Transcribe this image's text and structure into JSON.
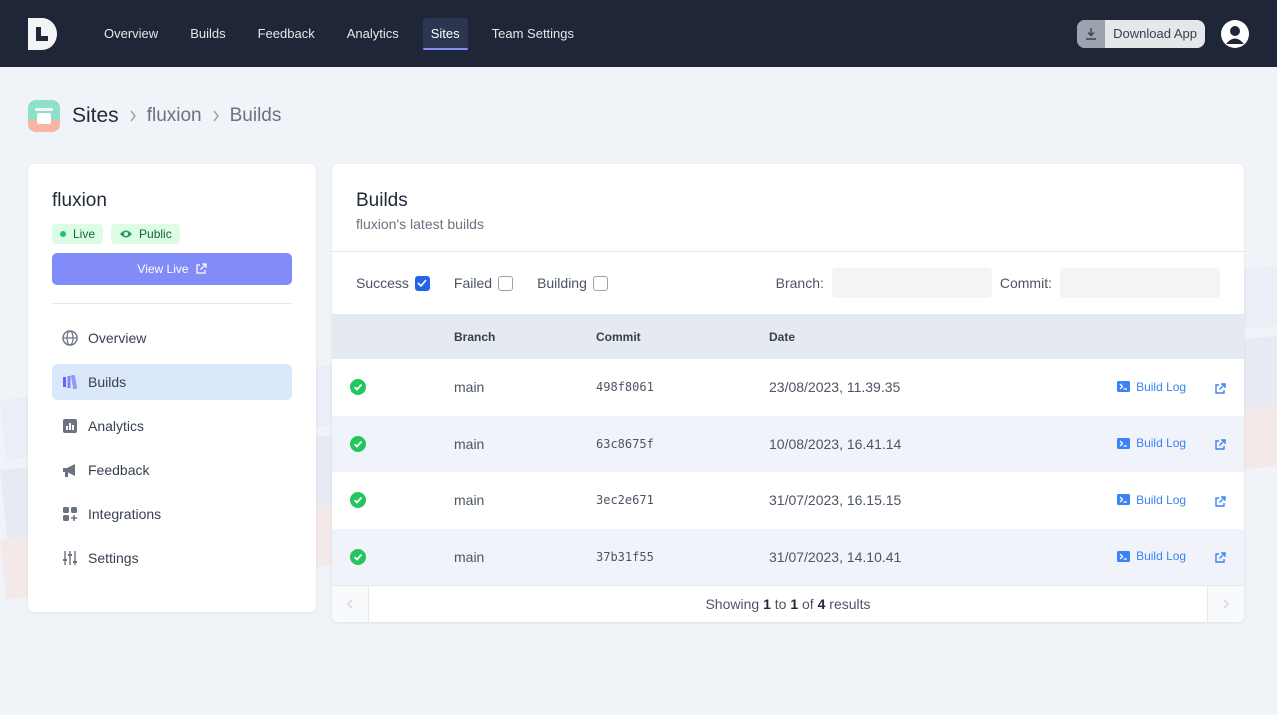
{
  "nav": {
    "items": [
      {
        "label": "Overview",
        "active": false
      },
      {
        "label": "Builds",
        "active": false
      },
      {
        "label": "Feedback",
        "active": false
      },
      {
        "label": "Analytics",
        "active": false
      },
      {
        "label": "Sites",
        "active": true
      },
      {
        "label": "Team Settings",
        "active": false
      }
    ],
    "download_label": "Download App"
  },
  "breadcrumb": [
    "Sites",
    "fluxion",
    "Builds"
  ],
  "site": {
    "name": "fluxion",
    "badges": {
      "live": "Live",
      "public": "Public"
    },
    "view_live_label": "View Live",
    "menu": [
      {
        "label": "Overview",
        "icon": "globe-icon",
        "active": false
      },
      {
        "label": "Builds",
        "icon": "builds-icon",
        "active": true
      },
      {
        "label": "Analytics",
        "icon": "bar-chart-icon",
        "active": false
      },
      {
        "label": "Feedback",
        "icon": "megaphone-icon",
        "active": false
      },
      {
        "label": "Integrations",
        "icon": "puzzle-icon",
        "active": false
      },
      {
        "label": "Settings",
        "icon": "sliders-icon",
        "active": false
      }
    ]
  },
  "builds": {
    "title": "Builds",
    "subtitle": "fluxion's latest builds",
    "filters": {
      "success": "Success",
      "failed": "Failed",
      "building": "Building",
      "branch": "Branch:",
      "commit": "Commit:"
    },
    "columns": {
      "branch": "Branch",
      "commit": "Commit",
      "date": "Date"
    },
    "rows": [
      {
        "branch": "main",
        "commit": "498f8061",
        "date": "23/08/2023, 11.39.35",
        "log": "Build Log"
      },
      {
        "branch": "main",
        "commit": "63c8675f",
        "date": "10/08/2023, 16.41.14",
        "log": "Build Log"
      },
      {
        "branch": "main",
        "commit": "3ec2e671",
        "date": "31/07/2023, 16.15.15",
        "log": "Build Log"
      },
      {
        "branch": "main",
        "commit": "37b31f55",
        "date": "31/07/2023, 14.10.41",
        "log": "Build Log"
      }
    ],
    "pagination": {
      "showing": "Showing",
      "from": "1",
      "to_word": "to",
      "to": "1",
      "of_word": "of",
      "total": "4",
      "results": "results"
    }
  },
  "colors": {
    "nav_bg": "#1e2637",
    "accent": "#818cf8",
    "success": "#22c55e",
    "link": "#3b82f6"
  }
}
